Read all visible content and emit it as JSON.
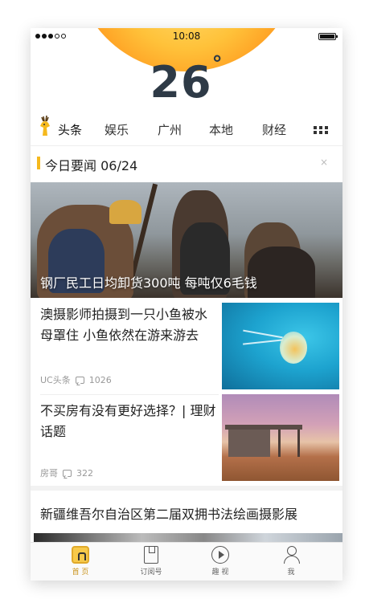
{
  "status_bar": {
    "time": "10:08"
  },
  "weather": {
    "temperature": "26",
    "degree": "°"
  },
  "tabs": [
    {
      "label": "头条",
      "active": true
    },
    {
      "label": "娱乐"
    },
    {
      "label": "广州"
    },
    {
      "label": "本地"
    },
    {
      "label": "财经"
    }
  ],
  "section": {
    "title": "今日要闻 06/24",
    "close": "×"
  },
  "hero": {
    "caption": "钢厂民工日均卸货300吨 每吨仅6毛钱"
  },
  "news": [
    {
      "title": "澳摄影师拍摄到一只小鱼被水母罩住 小鱼依然在游来游去",
      "source": "UC头条",
      "comments": "1026",
      "thumb": "jellyfish-fish"
    },
    {
      "title": "不买房有没有更好选择？| 理财话题",
      "source": "房哥",
      "comments": "322",
      "thumb": "desert-house"
    }
  ],
  "headline": {
    "title": "新疆维吾尔自治区第二届双拥书法绘画摄影展"
  },
  "bottom_nav": [
    {
      "label": "首 页",
      "icon": "home-icon",
      "active": true
    },
    {
      "label": "订阅号",
      "icon": "bookmark-icon"
    },
    {
      "label": "趣 视",
      "icon": "play-icon"
    },
    {
      "label": "我",
      "icon": "person-icon"
    }
  ],
  "colors": {
    "accent": "#f5b91e",
    "sun_outer": "#ff5522",
    "sun_inner": "#ffe27a"
  }
}
